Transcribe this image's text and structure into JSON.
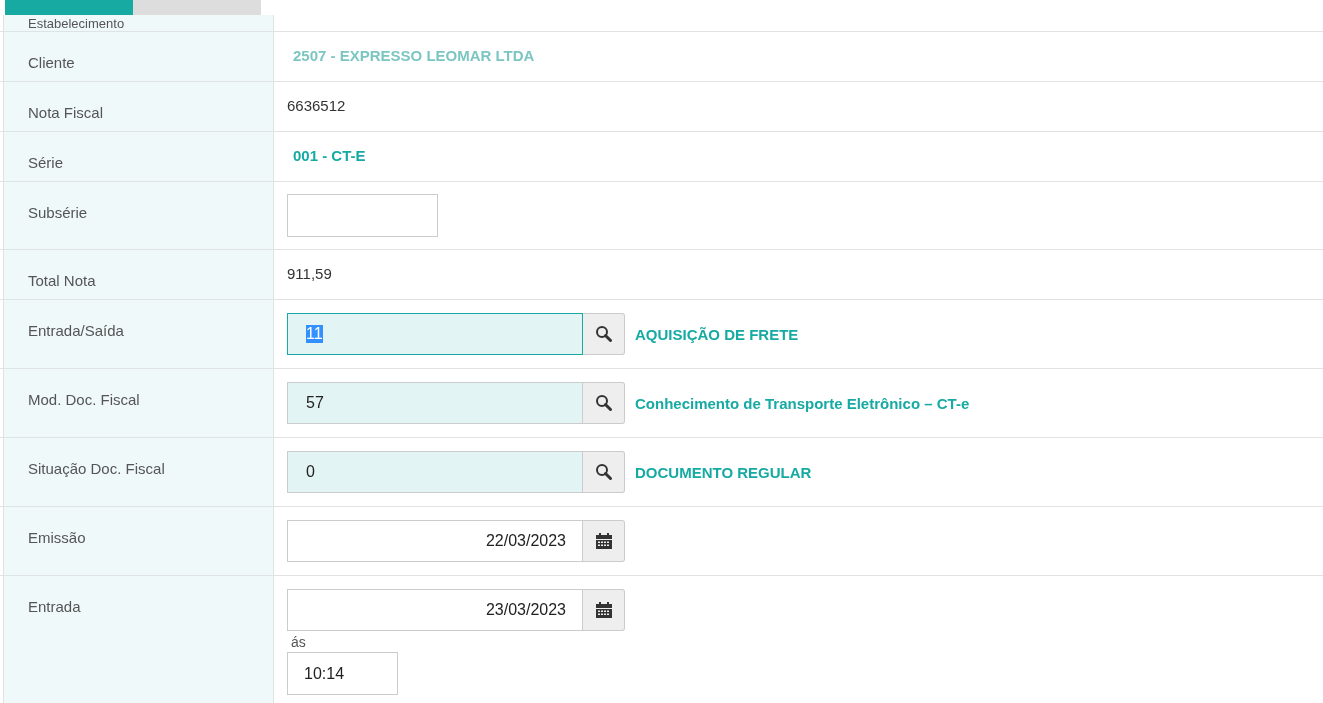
{
  "tabs": [
    {
      "selected": true
    },
    {
      "selected": false
    }
  ],
  "rows": [
    {
      "label": "Estabelecimento",
      "kind": "blank"
    },
    {
      "label": "Cliente",
      "kind": "faded",
      "value": "2507 - EXPRESSO LEOMAR LTDA"
    },
    {
      "label": "Nota Fiscal",
      "kind": "text",
      "value": "6636512"
    },
    {
      "label": "Série",
      "kind": "link",
      "value": "001 - CT-E"
    },
    {
      "label": "Subsérie",
      "kind": "input",
      "value": ""
    },
    {
      "label": "Total Nota",
      "kind": "text",
      "value": "911,59"
    },
    {
      "label": "Entrada/Saída",
      "kind": "lookup",
      "value": "11",
      "focused": true,
      "description": "AQUISIÇÃO DE FRETE"
    },
    {
      "label": "Mod. Doc. Fiscal",
      "kind": "lookup",
      "value": "57",
      "focused": false,
      "description": "Conhecimento de Transporte Eletrônico – CT-e"
    },
    {
      "label": "Situação Doc. Fiscal",
      "kind": "lookup",
      "value": "0",
      "focused": false,
      "description": "DOCUMENTO REGULAR"
    },
    {
      "label": "Emissão",
      "kind": "date",
      "value": "22/03/2023"
    },
    {
      "label": "Entrada",
      "kind": "datetime",
      "value": "23/03/2023",
      "at_label": "ás",
      "time": "10:14"
    }
  ]
}
